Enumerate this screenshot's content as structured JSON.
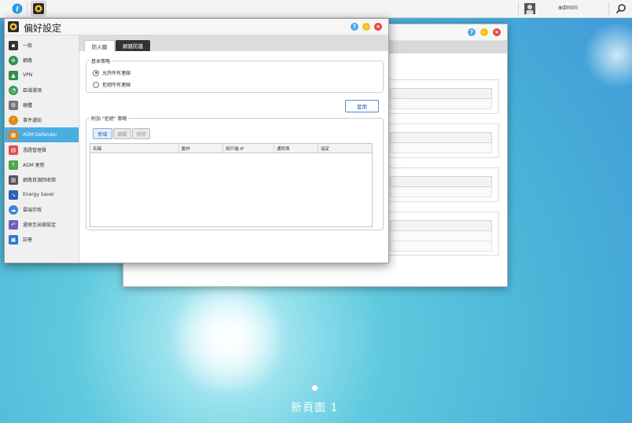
{
  "taskbar": {
    "user": "admin",
    "icons": [
      "info-icon",
      "settings-app-icon",
      "user-icon",
      "search-icon"
    ]
  },
  "desktop": {
    "page_label": "新頁面 1"
  },
  "window": {
    "title": "偏好設定",
    "controls": {
      "help": "?",
      "minimize": "–",
      "close": "×"
    },
    "colors": {
      "help": "#4aa8e8",
      "minimize": "#f2c21b",
      "close": "#e8433c",
      "active_sidebar": "#4aaee3"
    }
  },
  "sidebar": {
    "items": [
      {
        "label": "一般",
        "icon": "general-icon"
      },
      {
        "label": "網路",
        "icon": "network-icon"
      },
      {
        "label": "VPN",
        "icon": "vpn-icon"
      },
      {
        "label": "區域選項",
        "icon": "region-icon"
      },
      {
        "label": "硬體",
        "icon": "hardware-icon"
      },
      {
        "label": "事件通知",
        "icon": "notification-icon"
      },
      {
        "label": "ADM Defender",
        "icon": "defender-icon"
      },
      {
        "label": "憑證管理員",
        "icon": "certificate-icon"
      },
      {
        "label": "ADM 更新",
        "icon": "update-icon"
      },
      {
        "label": "網路資源回收筒",
        "icon": "recycle-bin-icon"
      },
      {
        "label": "Energy Saver",
        "icon": "energy-saver-icon"
      },
      {
        "label": "雲端存取",
        "icon": "cloud-access-icon"
      },
      {
        "label": "還原至出廠設定",
        "icon": "factory-reset-icon"
      },
      {
        "label": "註冊",
        "icon": "registration-icon"
      }
    ],
    "active_index": 6
  },
  "tabs": [
    {
      "label": "防火牆",
      "active": false
    },
    {
      "label": "網路防護",
      "active": true
    }
  ],
  "basic_policy": {
    "legend": "基本策略",
    "options": [
      {
        "label": "允許所有連線",
        "selected": true
      },
      {
        "label": "拒絕所有連線",
        "selected": false
      }
    ],
    "apply_label": "套用"
  },
  "extra_policy": {
    "legend": "附加 \"拒絕\" 策略",
    "buttons": {
      "add": "新增",
      "edit": "編輯",
      "remove": "移除"
    },
    "columns": [
      "名稱",
      "動作",
      "用戶端 IP",
      "通訊埠",
      "協定"
    ],
    "rows": []
  }
}
